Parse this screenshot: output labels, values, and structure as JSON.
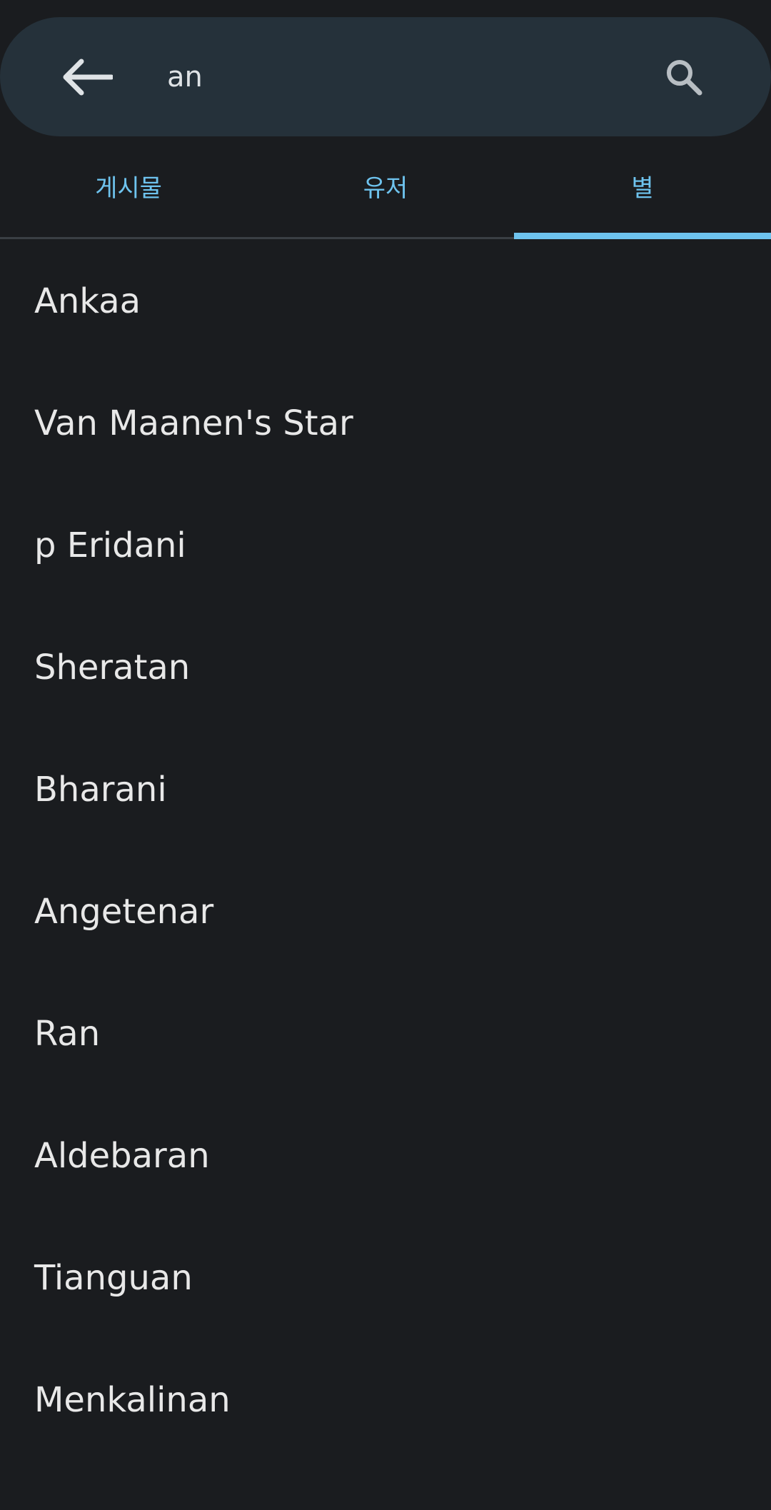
{
  "search": {
    "query": "an",
    "back_icon": "arrow-left-icon",
    "search_icon": "magnifier-icon"
  },
  "tabs": [
    {
      "label": "게시물",
      "active": false
    },
    {
      "label": "유저",
      "active": false
    },
    {
      "label": "별",
      "active": true
    }
  ],
  "results": [
    "Ankaa",
    "Van Maanen's Star",
    "p Eridani",
    "Sheratan",
    "Bharani",
    "Angetenar",
    "Ran",
    "Aldebaran",
    "Tianguan",
    "Menkalinan"
  ],
  "colors": {
    "background": "#1a1c1f",
    "search_bar": "#25313a",
    "accent": "#6ec3ee",
    "text": "#e8e8e8"
  }
}
